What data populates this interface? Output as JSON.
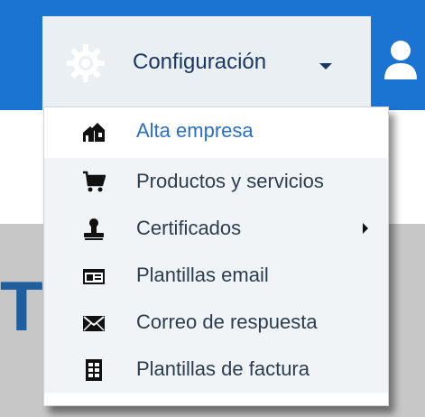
{
  "menu": {
    "title": "Configuración",
    "items": [
      {
        "label": "Alta empresa",
        "icon": "buildings-icon"
      },
      {
        "label": "Productos y servicios",
        "icon": "cart-icon"
      },
      {
        "label": "Certificados",
        "icon": "stamp-icon"
      },
      {
        "label": "Plantillas email",
        "icon": "email-template-icon"
      },
      {
        "label": "Correo de respuesta",
        "icon": "envelope-icon"
      },
      {
        "label": "Plantillas de factura",
        "icon": "invoice-template-icon"
      }
    ]
  },
  "background": {
    "partial_letter": "T"
  },
  "colors": {
    "topbar": "#1b74d1",
    "active_item": "#2b6fc5",
    "menu_text": "#2b3d4f"
  }
}
